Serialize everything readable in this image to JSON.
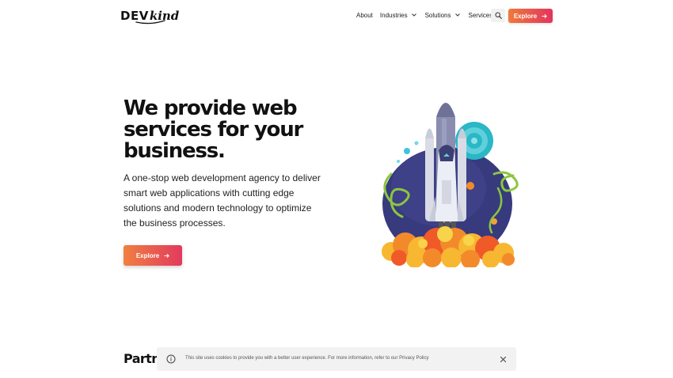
{
  "header": {
    "logo_part1": "DEV",
    "logo_part2": "kind",
    "nav": {
      "about": "About",
      "industries": "Industries",
      "solutions": "Solutions",
      "services": "Services"
    },
    "explore_label": "Explore"
  },
  "hero": {
    "title": "We provide web services for your business.",
    "description": "A one-stop web development agency to deliver smart web applications with cutting edge solutions and modern technology to optimize the business processes.",
    "explore_label": "Explore"
  },
  "partners": {
    "heading": "Partners"
  },
  "cookie": {
    "text": "This site uses cookies to provide you with a better user experience. For more information, refer to our Privacy Policy"
  },
  "colors": {
    "accent_start": "#f07a3a",
    "accent_end": "#e2345e",
    "text": "#111111",
    "cookie_bg": "#f2f2f3"
  }
}
